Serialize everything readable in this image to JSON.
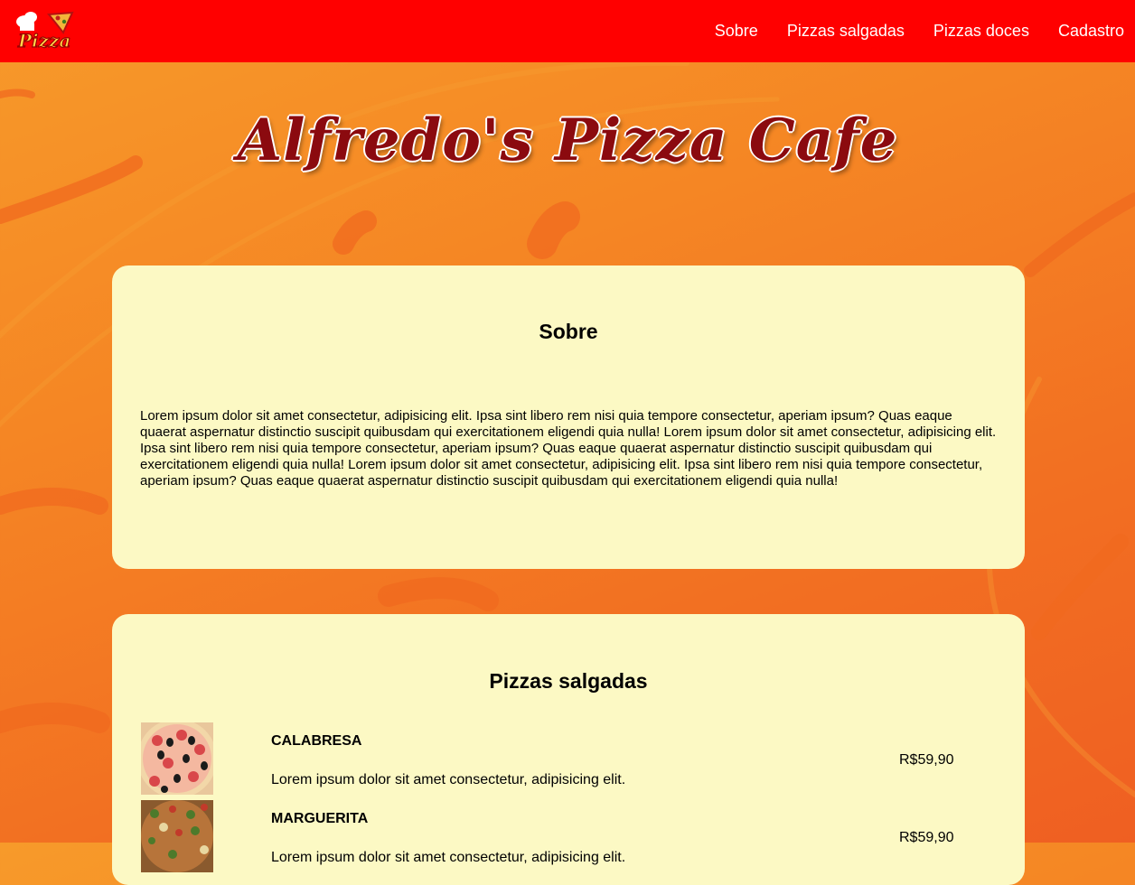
{
  "navbar": {
    "logo_text": "Pizza",
    "links": [
      "Sobre",
      "Pizzas salgadas",
      "Pizzas doces",
      "Cadastro"
    ]
  },
  "hero": {
    "title": "Alfredo's Pizza Cafe"
  },
  "sobre": {
    "heading": "Sobre",
    "text": "Lorem ipsum dolor sit amet consectetur, adipisicing elit. Ipsa sint libero rem nisi quia tempore consectetur, aperiam ipsum? Quas eaque quaerat aspernatur distinctio suscipit quibusdam qui exercitationem eligendi quia nulla! Lorem ipsum dolor sit amet consectetur, adipisicing elit. Ipsa sint libero rem nisi quia tempore consectetur, aperiam ipsum? Quas eaque quaerat aspernatur distinctio suscipit quibusdam qui exercitationem eligendi quia nulla! Lorem ipsum dolor sit amet consectetur, adipisicing elit. Ipsa sint libero rem nisi quia tempore consectetur, aperiam ipsum? Quas eaque quaerat aspernatur distinctio suscipit quibusdam qui exercitationem eligendi quia nulla!"
  },
  "salgadas": {
    "heading": "Pizzas salgadas",
    "items": [
      {
        "name": "CALABRESA",
        "description": "Lorem ipsum dolor sit amet consectetur, adipisicing elit.",
        "price": "R$59,90",
        "image_icon": "pepperoni-pizza-image"
      },
      {
        "name": "MARGUERITA",
        "description": "Lorem ipsum dolor sit amet consectetur, adipisicing elit.",
        "price": "R$59,90",
        "image_icon": "margherita-pizza-image"
      }
    ]
  },
  "colors": {
    "navbar": "#ff0000",
    "card": "#fcf9c4",
    "title": "#8b0a0f",
    "background_orange": "#f58624"
  }
}
